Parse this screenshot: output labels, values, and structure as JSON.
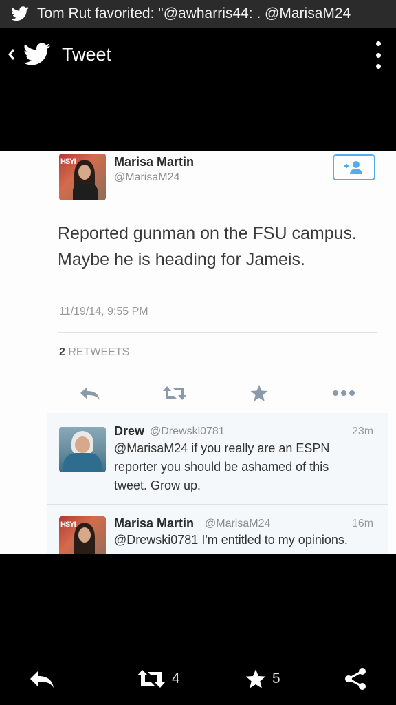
{
  "notification": {
    "icon": "twitter-bird-icon",
    "text": "Tom Rut favorited: \"@awharris44: . @MarisaM24"
  },
  "appbar": {
    "title": "Tweet",
    "back_icon": "chevron-left-icon",
    "logo_icon": "twitter-bird-icon",
    "menu_icon": "overflow-menu-icon"
  },
  "tweet": {
    "author_name": "Marisa Martin",
    "author_handle": "@MarisaM24",
    "text": "Reported gunman on the FSU campus. Maybe he is heading for Jameis.",
    "timestamp": "11/19/14, 9:55 PM",
    "retweet_count": "2",
    "retweet_label": "RETWEETS",
    "actions": [
      "reply-icon",
      "retweet-icon",
      "favorite-star-icon",
      "more-icon"
    ],
    "follow_icon": "follow-user-icon"
  },
  "replies": [
    {
      "name": "Drew",
      "handle": "@Drewski0781",
      "time": "23m",
      "text": "@MarisaM24 if you really are an ESPN reporter you should be ashamed of this tweet. Grow up."
    },
    {
      "name": "Marisa Martin",
      "handle": "@MarisaM24",
      "time": "16m",
      "text": "@Drewski0781 I'm entitled to my opinions."
    }
  ],
  "bottom_bar": {
    "reply_icon": "reply-icon",
    "retweet_icon": "retweet-icon",
    "retweet_count": "4",
    "favorite_icon": "star-icon",
    "favorite_count": "5",
    "share_icon": "share-icon"
  },
  "colors": {
    "background": "#000000",
    "notification_bar": "#2b2b2b",
    "twitter_blue": "#55acee",
    "card": "#fdfdfd",
    "reply_bg": "#f5f8fa"
  }
}
